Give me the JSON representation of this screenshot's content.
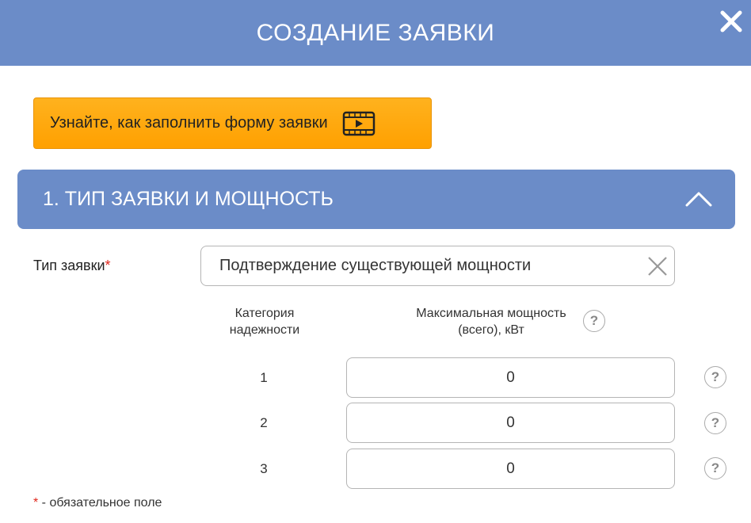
{
  "header": {
    "title": "СОЗДАНИЕ ЗАЯВКИ"
  },
  "video_button": {
    "label": "Узнайте, как заполнить форму заявки",
    "icon": "video-play-icon"
  },
  "section": {
    "title": "1. ТИП ЗАЯВКИ И МОЩНОСТЬ",
    "expanded": true
  },
  "request_type": {
    "label": "Тип заявки",
    "required_mark": "*",
    "value": "Подтверждение существующей мощности"
  },
  "power_table": {
    "headers": {
      "category": "Категория надежности",
      "power": "Максимальная мощность (всего), кВт"
    },
    "rows": [
      {
        "category": "1",
        "value": "0"
      },
      {
        "category": "2",
        "value": "0"
      },
      {
        "category": "3",
        "value": "0"
      }
    ]
  },
  "help_glyph": "?",
  "footnote": {
    "star": "*",
    "text": " - обязательное поле"
  },
  "colors": {
    "header_bg": "#6b8cc8",
    "accent_orange": "#ffa000",
    "required": "#e0261c"
  }
}
